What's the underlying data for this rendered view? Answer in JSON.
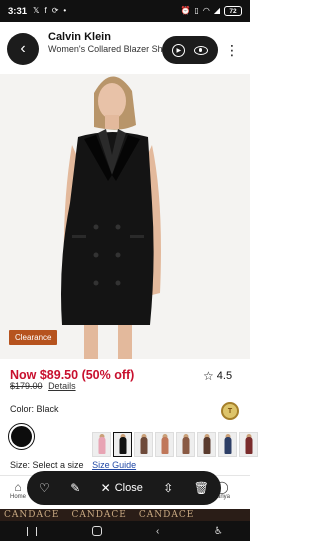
{
  "status_bar": {
    "time": "3:31",
    "left_icons": [
      "x-logo-icon",
      "facebook-icon",
      "sync-icon",
      "dot-icon"
    ],
    "right_icons": [
      "alarm-icon",
      "vibrate-icon",
      "wifi-icon",
      "signal-icon"
    ],
    "battery": "72"
  },
  "header": {
    "brand": "Calvin Klein",
    "product_name": "Women's Collared Blazer Sh"
  },
  "badge": {
    "clearance": "Clearance"
  },
  "price": {
    "now": "Now $89.50 (50% off)",
    "was": "$179.00",
    "details_link": "Details"
  },
  "rating": {
    "value": "4.5"
  },
  "color": {
    "label": "Color: Black",
    "selected_swatch": "#0d0d0d",
    "badge_text": "T"
  },
  "thumbnails": [
    {
      "name": "thumb-pink-dress",
      "fill": "#e8a4b4"
    },
    {
      "name": "thumb-black-dress-selected",
      "fill": "#111111"
    },
    {
      "name": "thumb-look-1",
      "fill": "#6e4a3a"
    },
    {
      "name": "thumb-look-2",
      "fill": "#c0775a"
    },
    {
      "name": "thumb-look-3",
      "fill": "#8a5a44"
    },
    {
      "name": "thumb-look-4",
      "fill": "#5a3b2e"
    },
    {
      "name": "thumb-look-5",
      "fill": "#2d3e66"
    },
    {
      "name": "thumb-look-6",
      "fill": "#7a2c2c"
    }
  ],
  "size": {
    "label": "Size: Select a size",
    "guide_link": "Size Guide"
  },
  "bottom_nav": {
    "home": "Home",
    "account": "Tanya"
  },
  "overlay": {
    "close_label": "Close"
  },
  "banner": {
    "repeat_text": [
      "CANDACE",
      "CANDACE",
      "CANDACE"
    ]
  },
  "colors": {
    "sale_red": "#c8102e",
    "clearance_orange": "#b6531e",
    "link_blue": "#2249a6"
  }
}
